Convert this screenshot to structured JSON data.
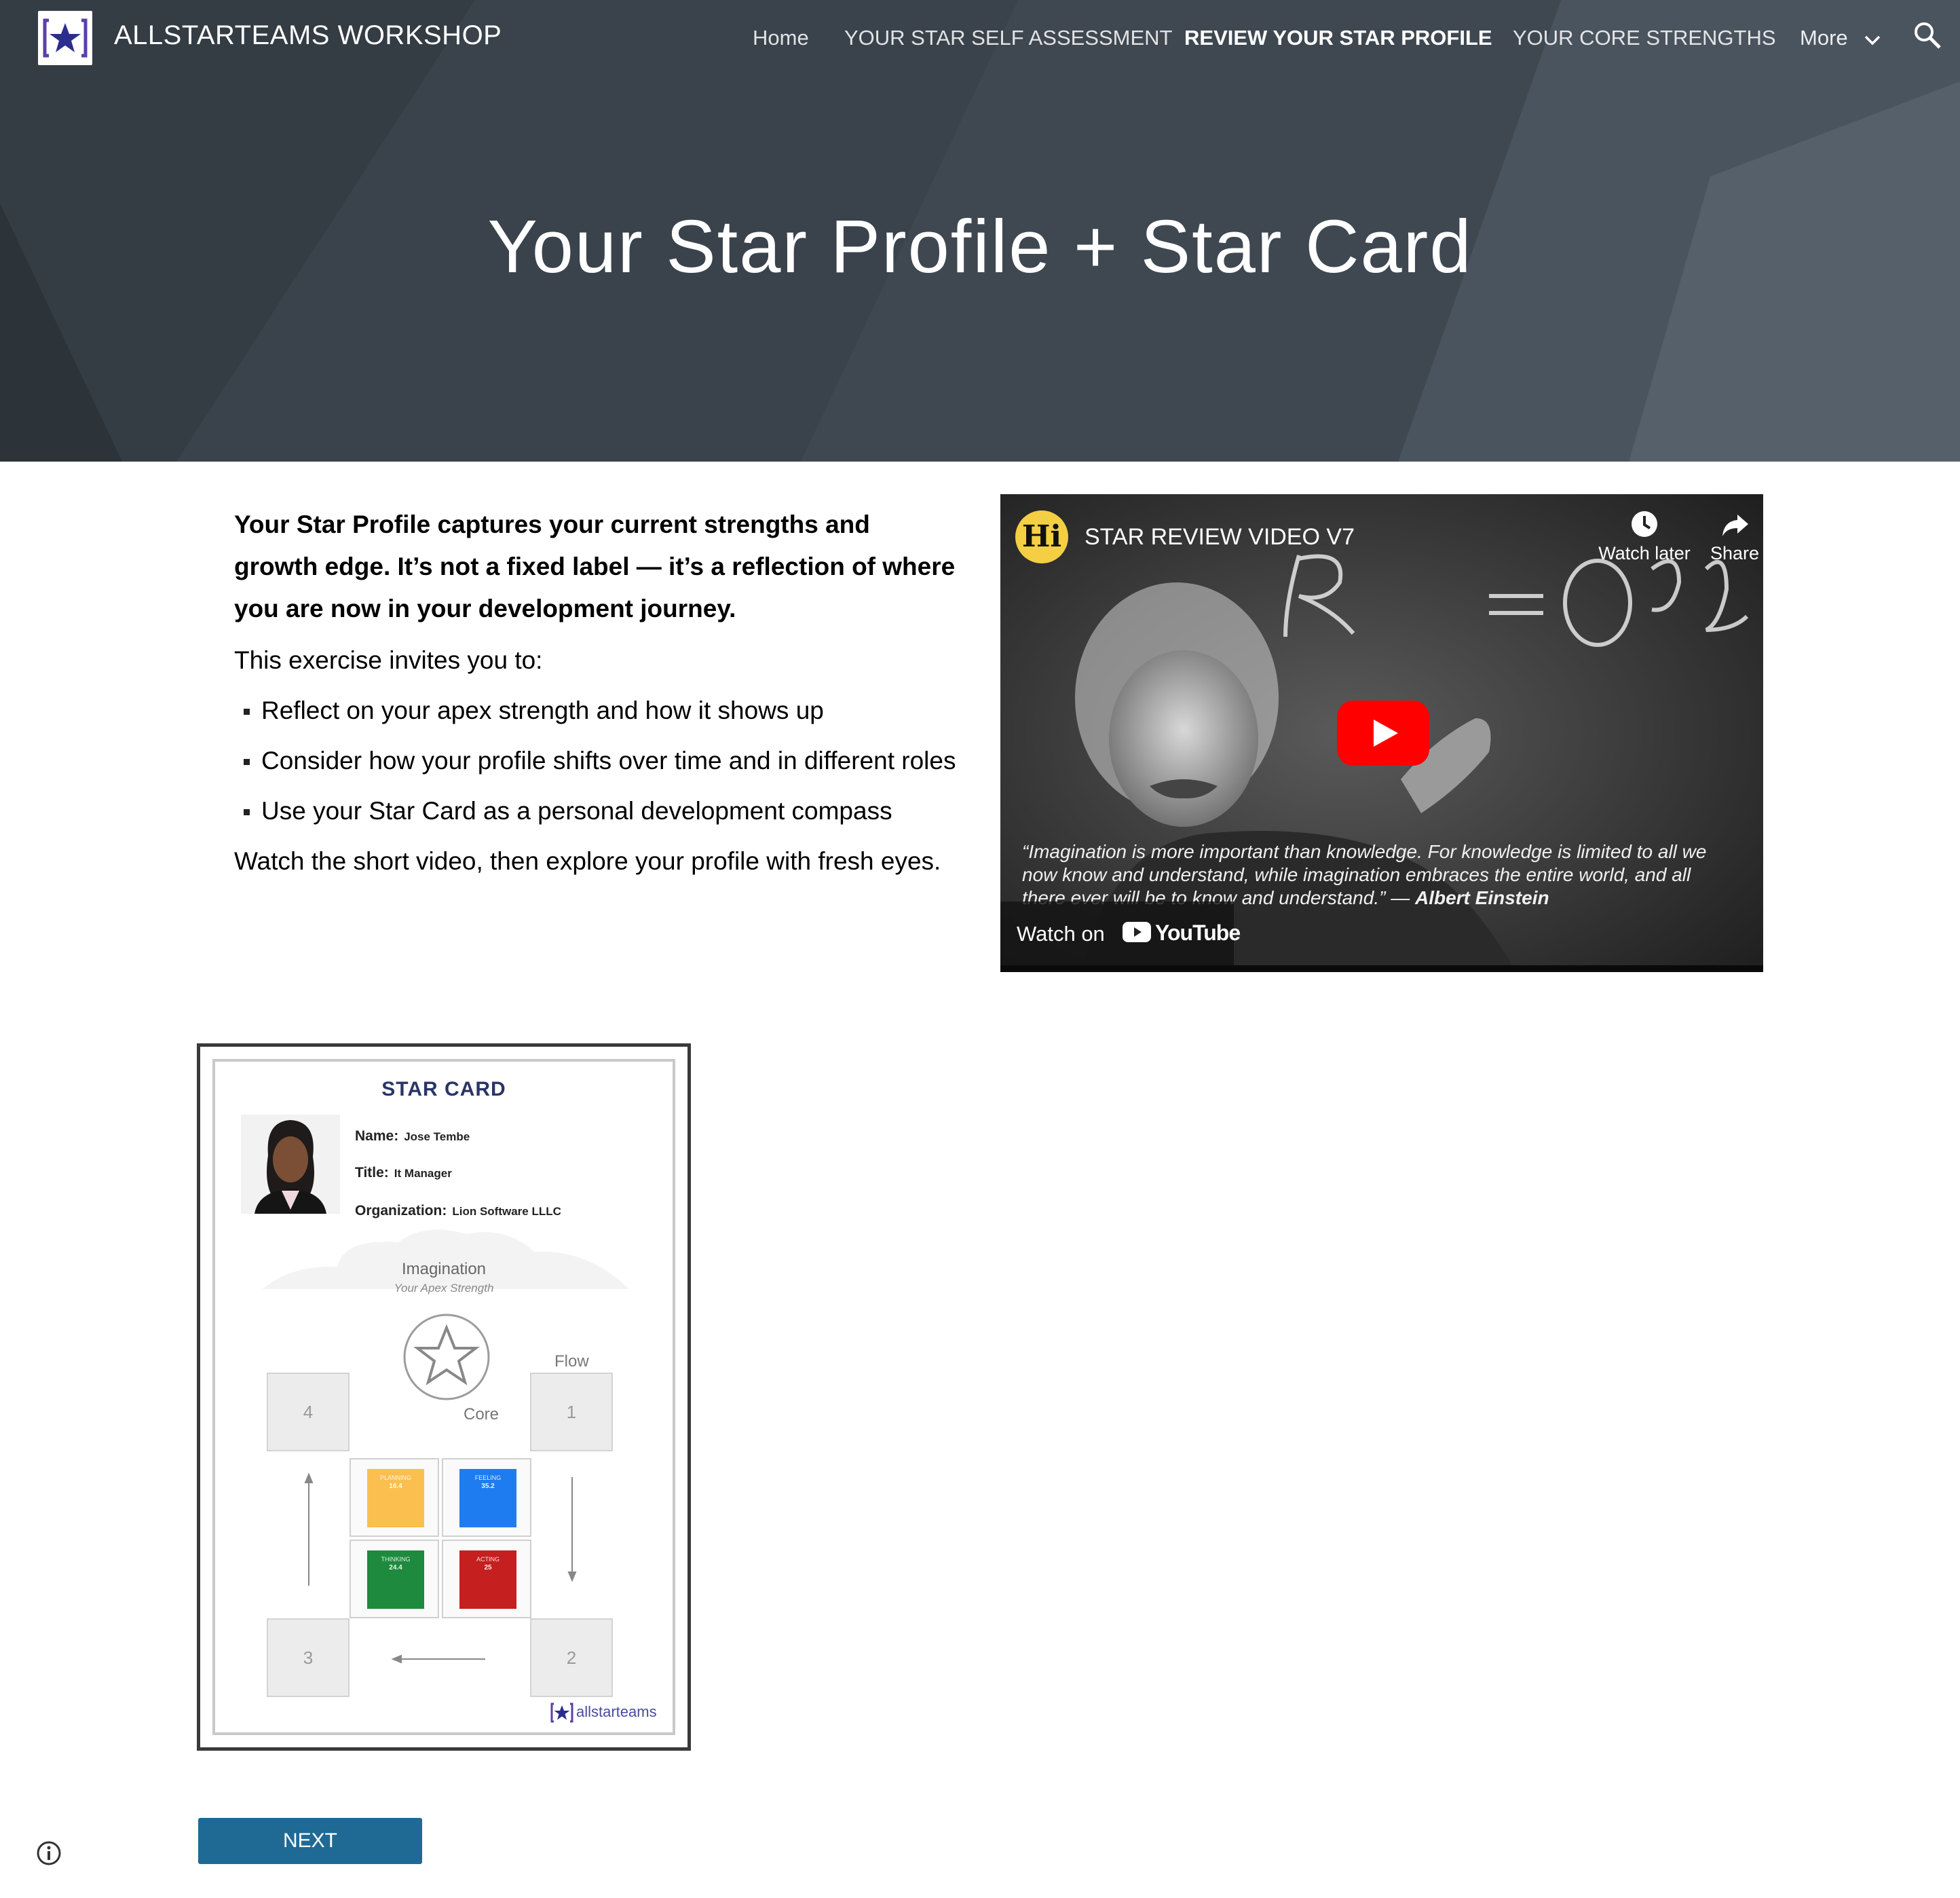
{
  "header": {
    "site_title": "ALLSTARTEAMS WORKSHOP",
    "nav": [
      {
        "label": "Home",
        "active": false
      },
      {
        "label": "YOUR STAR SELF ASSESSMENT",
        "active": false
      },
      {
        "label": "REVIEW YOUR STAR PROFILE",
        "active": true
      },
      {
        "label": "YOUR CORE STRENGTHS",
        "active": false
      }
    ],
    "more_label": "More",
    "icons": {
      "logo": "allstarteams-logo-icon",
      "more": "chevron-down-icon",
      "search": "search-icon"
    }
  },
  "hero": {
    "title": "Your Star Profile + Star Card"
  },
  "intro": {
    "lead": "Your Star Profile captures your current strengths and growth edge. It’s not a fixed label — it’s a reflection of where you are now in your development journey.",
    "invite": "This exercise invites you to:",
    "bullets": [
      "Reflect on your apex strength and how it shows up",
      "Consider how your profile shifts over time and in different roles",
      "Use your Star Card as a personal development compass"
    ],
    "closing": "Watch the short video, then explore your profile with fresh eyes."
  },
  "video": {
    "channel_avatar": "Hi",
    "title": "STAR REVIEW VIDEO V7",
    "watch_later": "Watch later",
    "share": "Share",
    "quote": "“Imagination is more important than knowledge. For knowledge is limited to all we now know and understand, while imagination embraces the entire world, and all there ever will be to know and understand.” —",
    "quote_author": "Albert Einstein",
    "watch_on": "Watch on",
    "youtube": "YouTube",
    "icons": {
      "watch_later": "clock-icon",
      "share": "share-arrow-icon",
      "play": "youtube-play-icon"
    }
  },
  "star_card": {
    "title": "STAR CARD",
    "name_label": "Name:",
    "name": "Jose Tembe",
    "title_label": "Title:",
    "job_title": "It Manager",
    "org_label": "Organization:",
    "organization": "Lion Software LLLC",
    "apex": "Imagination",
    "apex_sub": "Your Apex Strength",
    "flow_label": "Flow",
    "core_label": "Core",
    "flow_boxes": [
      "4",
      "1",
      "3",
      "2"
    ],
    "quadrants": [
      {
        "name": "PLANNING",
        "value": "16.4",
        "color": "#fbbf4f"
      },
      {
        "name": "FEELING",
        "value": "35.2",
        "color": "#1f7cf0"
      },
      {
        "name": "THINKING",
        "value": "24.4",
        "color": "#1e8a3e"
      },
      {
        "name": "ACTING",
        "value": "25",
        "color": "#c51f1f"
      }
    ],
    "brand": "allstarteams"
  },
  "next_button": "NEXT",
  "info_icon": "info-icon"
}
